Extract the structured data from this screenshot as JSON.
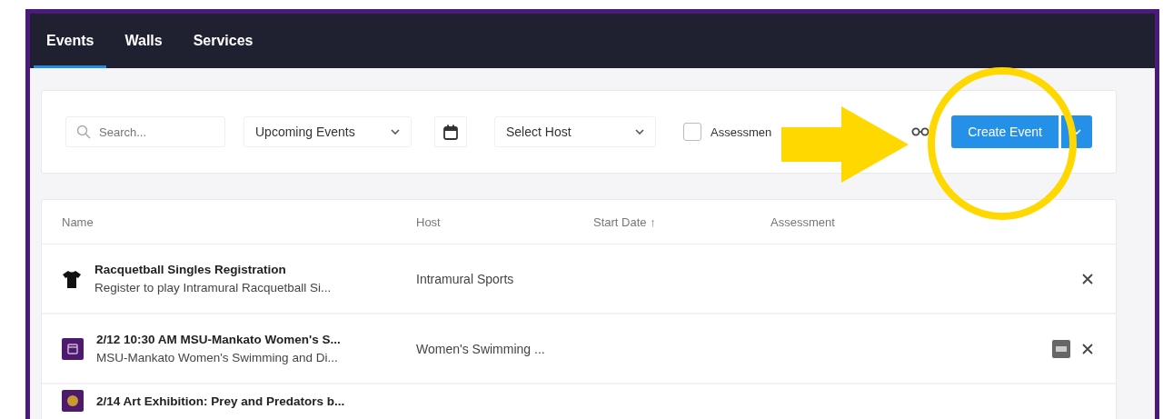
{
  "nav": {
    "tabs": [
      {
        "label": "Events",
        "selected": true
      },
      {
        "label": "Walls",
        "selected": false
      },
      {
        "label": "Services",
        "selected": false
      }
    ]
  },
  "filters": {
    "search": {
      "placeholder": "Search..."
    },
    "view_select": {
      "value": "Upcoming Events"
    },
    "host_select": {
      "value": "Select Host"
    },
    "assessment": {
      "label": "Assessmen",
      "checked": false
    },
    "create_button": {
      "label": "Create Event"
    }
  },
  "table": {
    "columns": [
      {
        "label": "Name"
      },
      {
        "label": "Host"
      },
      {
        "label": "Start Date ↑"
      },
      {
        "label": "Assessment"
      }
    ],
    "rows": [
      {
        "kind": "shirt",
        "title": "Racquetball Singles Registration",
        "description": "Register to play Intramural Racquetball Si...",
        "host": "Intramural Sports",
        "badge": false
      },
      {
        "kind": "calendar",
        "title": "2/12 10:30 AM MSU-Mankato Women's S...",
        "description": "MSU-Mankato Women's Swimming and Di...",
        "host": "Women's Swimming ...",
        "badge": true
      },
      {
        "kind": "calendar-gold",
        "title": "2/14 Art Exhibition: Prey and Predators b..."
      }
    ]
  }
}
